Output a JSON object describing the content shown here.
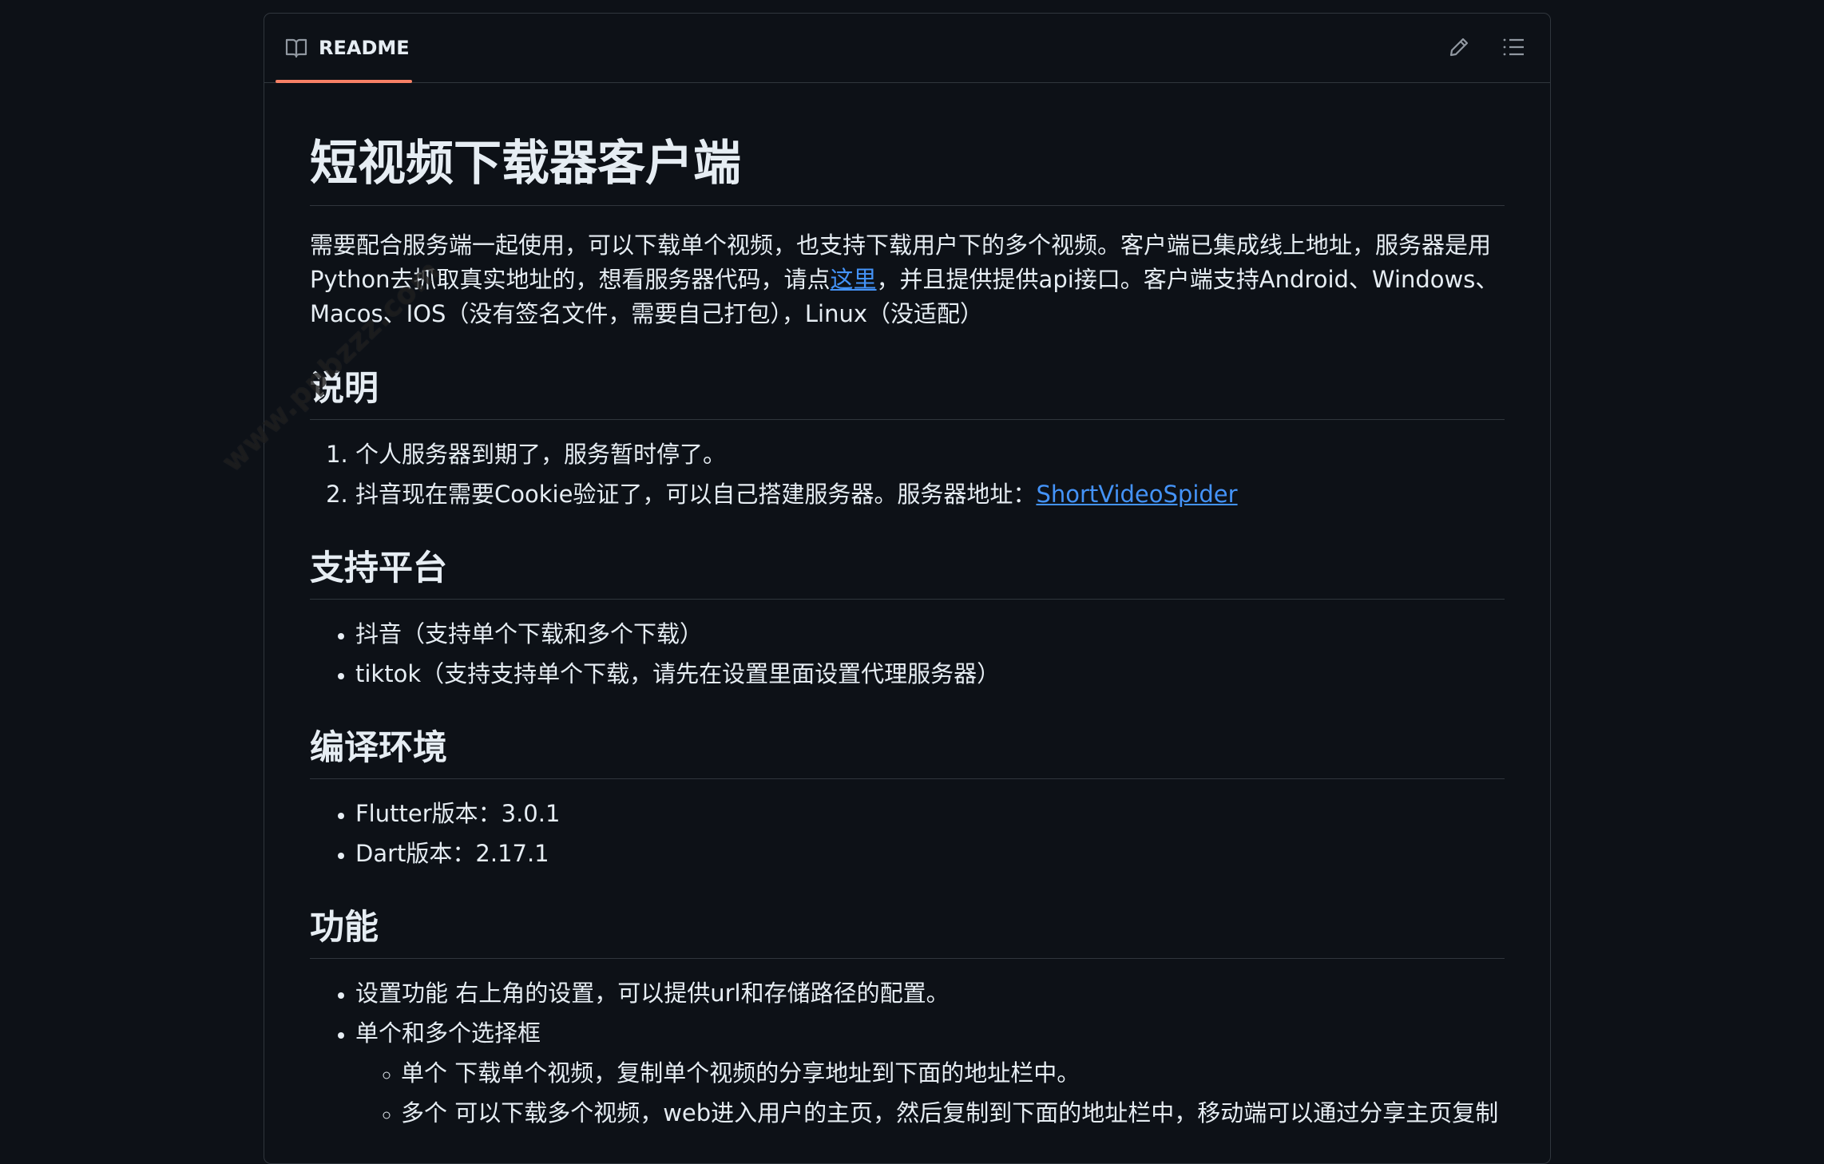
{
  "header": {
    "tab_label": "README",
    "icons": {
      "tab": "book-icon",
      "edit": "pencil-icon",
      "outline": "list-icon"
    }
  },
  "readme": {
    "title": "短视频下载器客户端",
    "intro_before_link": "需要配合服务端一起使用，可以下载单个视频，也支持下载用户下的多个视频。客户端已集成线上地址，服务器是用Python去抓取真实地址的，想看服务器代码，请点",
    "intro_link": "这里",
    "intro_after_link": "，并且提供提供api接口。客户端支持Android、Windows、Macos、IOS（没有签名文件，需要自己打包），Linux（没适配）",
    "sections": {
      "notes": {
        "heading": "说明",
        "item1": "个人服务器到期了，服务暂时停了。",
        "item2_text": "抖音现在需要Cookie验证了，可以自己搭建服务器。服务器地址：",
        "item2_link": "ShortVideoSpider"
      },
      "platforms": {
        "heading": "支持平台",
        "item1": "抖音（支持单个下载和多个下载）",
        "item2": "tiktok（支持支持单个下载，请先在设置里面设置代理服务器）"
      },
      "env": {
        "heading": "编译环境",
        "item1": "Flutter版本：3.0.1",
        "item2": "Dart版本：2.17.1"
      },
      "features": {
        "heading": "功能",
        "item1": "设置功能 右上角的设置，可以提供url和存储路径的配置。",
        "item2": "单个和多个选择框",
        "sub1": "单个 下载单个视频，复制单个视频的分享地址到下面的地址栏中。",
        "sub2": "多个 可以下载多个视频，web进入用户的主页，然后复制到下面的地址栏中，移动端可以通过分享主页复制"
      }
    }
  },
  "watermark": "www.ppbzzz.com",
  "colors": {
    "background": "#0d1117",
    "border": "#30363d",
    "text": "#e6edf3",
    "link": "#4493f8",
    "tab_underline": "#f78166",
    "icon": "#9198a1"
  }
}
